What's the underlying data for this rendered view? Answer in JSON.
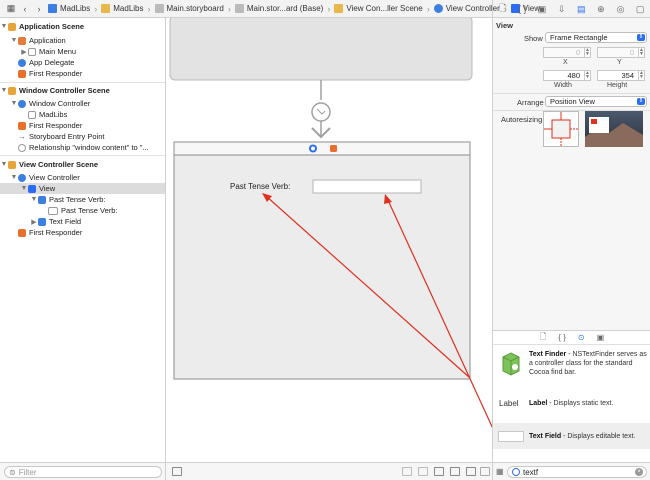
{
  "toolbar": {
    "breadcrumbs": [
      "MadLibs",
      "MadLibs",
      "Main.storyboard",
      "Main.stor...ard (Base)",
      "View Con...ller Scene",
      "View Controller",
      "View"
    ]
  },
  "outline": {
    "sections": [
      {
        "title": "Application Scene",
        "items": [
          "Application",
          "Main Menu",
          "App Delegate",
          "First Responder"
        ]
      },
      {
        "title": "Window Controller Scene",
        "items": [
          "Window Controller",
          "MadLibs",
          "First Responder",
          "Storyboard Entry Point",
          "Relationship \"window content\" to \"..."
        ]
      },
      {
        "title": "View Controller Scene",
        "items": [
          "View Controller",
          "View",
          "Past Tense Verb:",
          "Past Tense Verb:",
          "Text Field",
          "First Responder"
        ]
      }
    ],
    "filter_placeholder": "Filter"
  },
  "canvas": {
    "label_text": "Past Tense Verb:"
  },
  "inspector": {
    "title": "View",
    "show_label": "Show",
    "show_value": "Frame Rectangle",
    "x_value": "0",
    "y_value": "0",
    "x_label": "X",
    "y_label": "Y",
    "width_value": "480",
    "height_value": "354",
    "width_label": "Width",
    "height_label": "Height",
    "arrange_label": "Arrange",
    "arrange_value": "Position View",
    "autoresizing_label": "Autoresizing"
  },
  "library": {
    "items": [
      {
        "title": "Text Finder",
        "desc": " - NSTextFinder serves as a controller class for the standard Cocoa find bar."
      },
      {
        "title": "Label",
        "desc": " - Displays static text.",
        "preview": "Label"
      },
      {
        "title": "Text Field",
        "desc": " - Displays editable text."
      }
    ],
    "search_value": "textf"
  },
  "colors": {
    "accent": "#2a6df4",
    "selection": "#dcdcdc",
    "arrow": "#e0301e"
  }
}
